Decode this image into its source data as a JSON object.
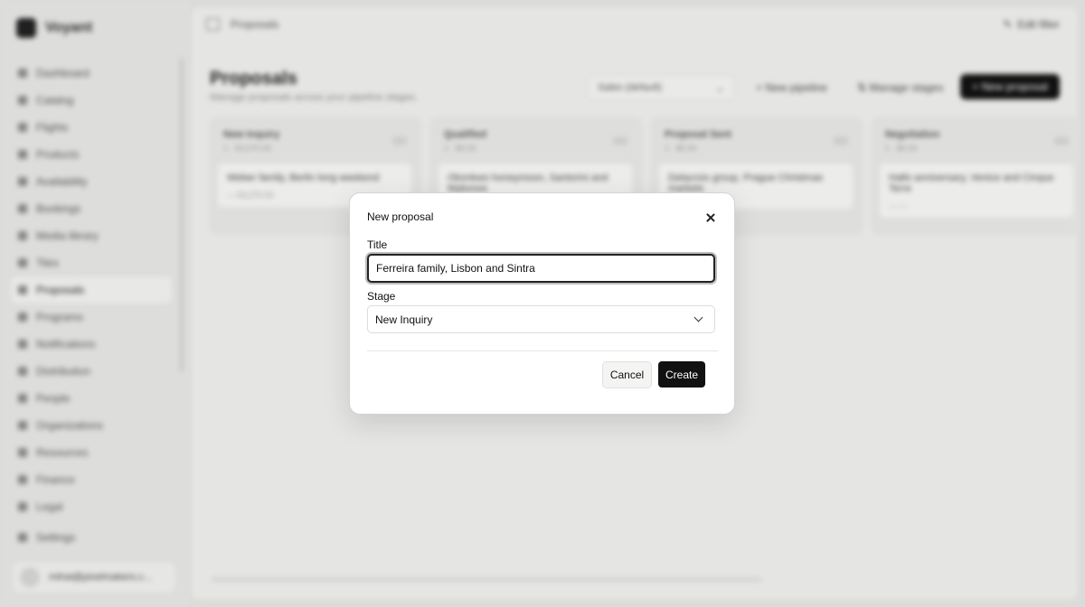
{
  "app": {
    "name": "Voyant"
  },
  "sidebar": {
    "items": [
      {
        "label": "Dashboard"
      },
      {
        "label": "Catalog"
      },
      {
        "label": "Flights"
      },
      {
        "label": "Products"
      },
      {
        "label": "Availability"
      },
      {
        "label": "Bookings"
      },
      {
        "label": "Media library"
      },
      {
        "label": "Tiles"
      },
      {
        "label": "Proposals",
        "active": true
      },
      {
        "label": "Programs"
      },
      {
        "label": "Notifications"
      },
      {
        "label": "Distribution"
      },
      {
        "label": "People"
      },
      {
        "label": "Organizations"
      },
      {
        "label": "Resources"
      },
      {
        "label": "Finance"
      },
      {
        "label": "Legal"
      }
    ],
    "settings_label": "Settings",
    "user_email": "mihai@pixelmakers.c..."
  },
  "header": {
    "breadcrumb": "Proposals",
    "edit_label": "Edit filter"
  },
  "page": {
    "title": "Proposals",
    "subtitle": "Manage proposals across your pipeline stages.",
    "pipeline_select": "Sales (default)",
    "new_pipeline_label": "New pipeline",
    "manage_stages_label": "Manage stages",
    "new_proposal_label": "New proposal"
  },
  "board": {
    "columns": [
      {
        "name": "New Inquiry",
        "value": "1 · €3,270.00",
        "card": {
          "title": "Weber family, Berlin long weekend",
          "meta": "— €3,270.00"
        }
      },
      {
        "name": "Qualified",
        "value": "1 · $0.00",
        "card": {
          "title": "Okonkwo honeymoon, Santorini and Mykonos",
          "meta": ""
        }
      },
      {
        "name": "Proposal Sent",
        "value": "1 · $0.00",
        "card": {
          "title": "Delacroix group, Prague Christmas markets",
          "meta": ""
        }
      },
      {
        "name": "Negotiation",
        "value": "1 · $0.00",
        "card": {
          "title": "Hallo anniversary, Venice and Cinque Terre",
          "meta": "— —"
        }
      }
    ]
  },
  "modal": {
    "title": "New proposal",
    "title_label": "Title",
    "title_value": "Ferreira family, Lisbon and Sintra",
    "stage_label": "Stage",
    "stage_value": "New Inquiry",
    "cancel_label": "Cancel",
    "create_label": "Create"
  }
}
